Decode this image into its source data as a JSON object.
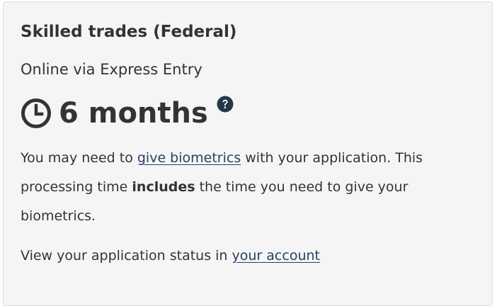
{
  "card": {
    "title": "Skilled trades (Federal)",
    "method": "Online via Express Entry",
    "duration": "6 months",
    "help_icon": "question-circle-icon",
    "clock_icon": "clock-icon"
  },
  "biometrics": {
    "text_before_link": "You may need to ",
    "link_text": "give biometrics",
    "text_after_link": " with your application. This processing time ",
    "bold_text": "includes",
    "text_end": " the time you need to give your biometrics."
  },
  "status": {
    "text_before_link": "View your application status in ",
    "link_text": "your account"
  },
  "colors": {
    "card_background": "#f5f5f5",
    "text": "#333333",
    "link": "#284162",
    "help_icon": "#26374a"
  }
}
